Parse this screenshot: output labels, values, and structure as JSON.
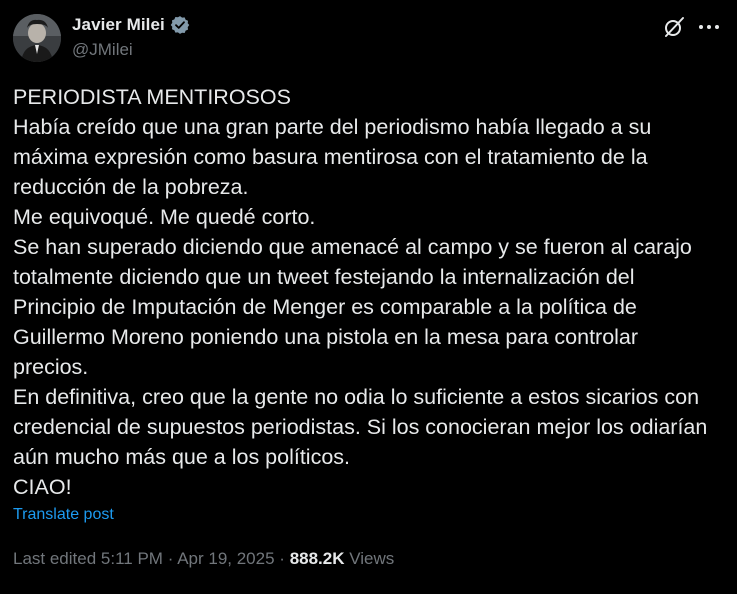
{
  "author": {
    "name": "Javier Milei",
    "handle": "@JMilei",
    "verified": true,
    "verified_color": "#829aab"
  },
  "actions": {
    "grok_icon": "grok-slash-icon",
    "more_icon": "more-horizontal-icon"
  },
  "post": {
    "lines": [
      "PERIODISTA MENTIROSOS",
      "Había creído que una gran parte del periodismo había llegado a su",
      "máxima expresión como basura mentirosa con el tratamiento de la",
      "reducción de la pobreza.",
      "Me equivoqué. Me quedé corto.",
      "Se han superado diciendo que amenacé al campo y se fueron al carajo",
      "totalmente diciendo que un tweet festejando la internalización del",
      "Principio de Imputación de Menger es comparable a la política de",
      "Guillermo Moreno poniendo una pistola en la mesa para controlar",
      "precios.",
      "En definitiva, creo que la gente no odia lo suficiente a estos sicarios con",
      "credencial de supuestos periodistas. Si los conocieran mejor los odiarían",
      "aún mucho más que a los políticos.",
      "CIAO!"
    ],
    "translate_label": "Translate post"
  },
  "meta": {
    "edited_label": "Last edited",
    "time": "5:11 PM",
    "separator": "·",
    "date": "Apr 19, 2025",
    "views_count": "888.2K",
    "views_label": "Views"
  },
  "colors": {
    "background": "#000000",
    "text_primary": "#e7e9ea",
    "text_secondary": "#71767b",
    "link": "#1d9bf0"
  }
}
